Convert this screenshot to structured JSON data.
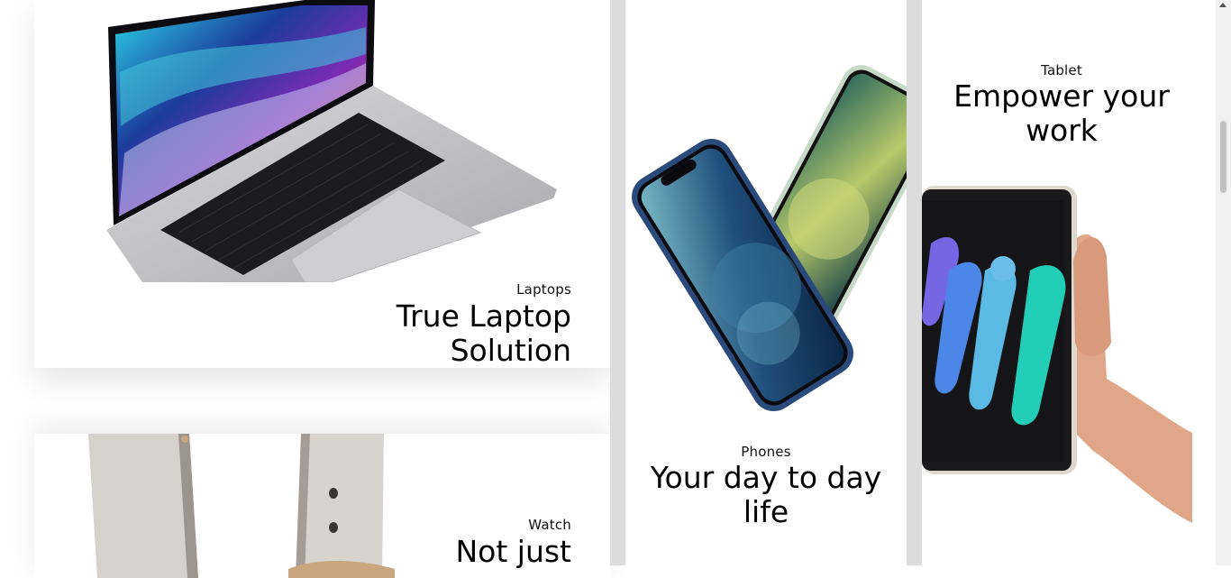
{
  "products": {
    "laptops": {
      "category": "Laptops",
      "heading": "True Laptop Solution",
      "image": "laptop-image"
    },
    "watch": {
      "category": "Watch",
      "heading": "Not just",
      "image": "watch-image"
    },
    "phones": {
      "category": "Phones",
      "heading": "Your day to day life",
      "image": "phones-image"
    },
    "tablet": {
      "category": "Tablet",
      "heading": "Empower your work",
      "image": "tablet-image"
    }
  },
  "colors": {
    "gutter": "#dcdcdc",
    "card": "#ffffff",
    "text": "#000000"
  }
}
